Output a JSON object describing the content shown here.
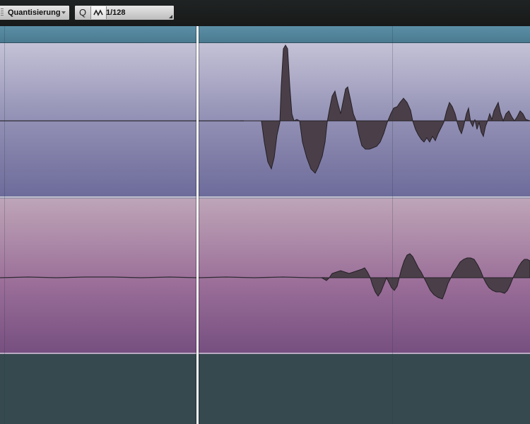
{
  "toolbar": {
    "quantize_label": "Quantisierung",
    "quantize_button": "Q",
    "iterative_icon": "iterative-quantize-icon",
    "quantize_value": "1/128"
  },
  "colors": {
    "toolbar_bg": "#1c1e1e",
    "ruler": "#5a8ea5",
    "lane1_top": "#c4c2d6",
    "lane1_bottom": "#6d6b9a",
    "lane2_top": "#bea5b8",
    "lane2_bottom": "#764f80",
    "empty_area": "#35494f",
    "waveform_fill": "#4a3f48",
    "cursor": "#ffffff"
  }
}
